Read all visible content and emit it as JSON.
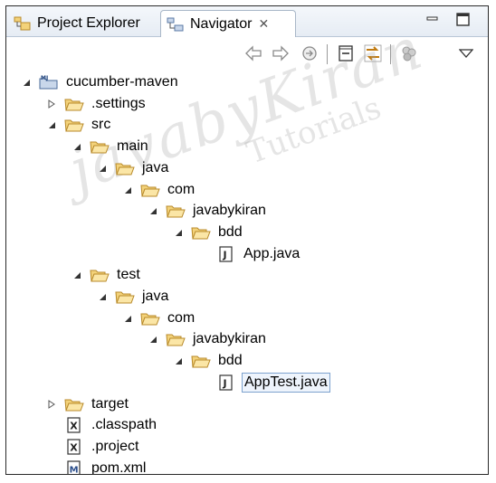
{
  "tabs": {
    "project_explorer": "Project Explorer",
    "navigator": "Navigator",
    "close_glyph": "✕"
  },
  "tree": [
    {
      "label": "cucumber-maven",
      "depth": 0,
      "kind": "project",
      "state": "open"
    },
    {
      "label": ".settings",
      "depth": 1,
      "kind": "folder",
      "state": "closed"
    },
    {
      "label": "src",
      "depth": 1,
      "kind": "folder",
      "state": "open"
    },
    {
      "label": "main",
      "depth": 2,
      "kind": "folder",
      "state": "open"
    },
    {
      "label": "java",
      "depth": 3,
      "kind": "folder",
      "state": "open"
    },
    {
      "label": "com",
      "depth": 4,
      "kind": "folder",
      "state": "open"
    },
    {
      "label": "javabykiran",
      "depth": 5,
      "kind": "folder",
      "state": "open"
    },
    {
      "label": "bdd",
      "depth": 6,
      "kind": "folder",
      "state": "open"
    },
    {
      "label": "App.java",
      "depth": 7,
      "kind": "java",
      "state": "leaf"
    },
    {
      "label": "test",
      "depth": 2,
      "kind": "folder",
      "state": "open"
    },
    {
      "label": "java",
      "depth": 3,
      "kind": "folder",
      "state": "open"
    },
    {
      "label": "com",
      "depth": 4,
      "kind": "folder",
      "state": "open"
    },
    {
      "label": "javabykiran",
      "depth": 5,
      "kind": "folder",
      "state": "open"
    },
    {
      "label": "bdd",
      "depth": 6,
      "kind": "folder",
      "state": "open"
    },
    {
      "label": "AppTest.java",
      "depth": 7,
      "kind": "java",
      "state": "leaf",
      "selected": true
    },
    {
      "label": "target",
      "depth": 1,
      "kind": "folder",
      "state": "closed"
    },
    {
      "label": ".classpath",
      "depth": 1,
      "kind": "xml",
      "state": "leaf"
    },
    {
      "label": ".project",
      "depth": 1,
      "kind": "xml",
      "state": "leaf"
    },
    {
      "label": "pom.xml",
      "depth": 1,
      "kind": "maven",
      "state": "leaf"
    }
  ],
  "watermark": {
    "line1": "javabyKiran",
    "line2": "Tutorials"
  },
  "colors": {
    "folder": "#f3d27a",
    "folder_edge": "#b88a2a",
    "selection_border": "#7da2ce"
  }
}
